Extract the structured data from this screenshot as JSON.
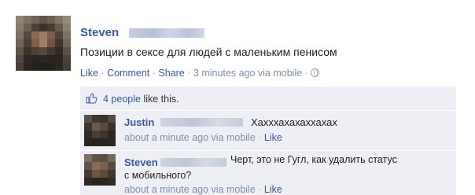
{
  "post": {
    "author": "Steven",
    "text": "Позиции в сексе для людей с маленьким пенисом",
    "actions": {
      "like": "Like",
      "comment": "Comment",
      "share": "Share",
      "time": "3 minutes ago via mobile",
      "separator": "·"
    }
  },
  "likes": {
    "count_link": "4 people",
    "suffix": "like this."
  },
  "comments": [
    {
      "author": "Justin",
      "text": "Хахххахахаххахах",
      "time": "about a minute ago via mobile",
      "separator": "·",
      "like": "Like"
    },
    {
      "author": "Steven",
      "text_line1": "Черт, это не Гугл, как удалить статус",
      "text_line2": "с мобильного?",
      "time": "about a minute ago via mobile",
      "separator": "·",
      "like": "Like"
    }
  ],
  "colors": {
    "link": "#3b5998",
    "meta": "#8090aa",
    "panel": "#edeff4"
  }
}
